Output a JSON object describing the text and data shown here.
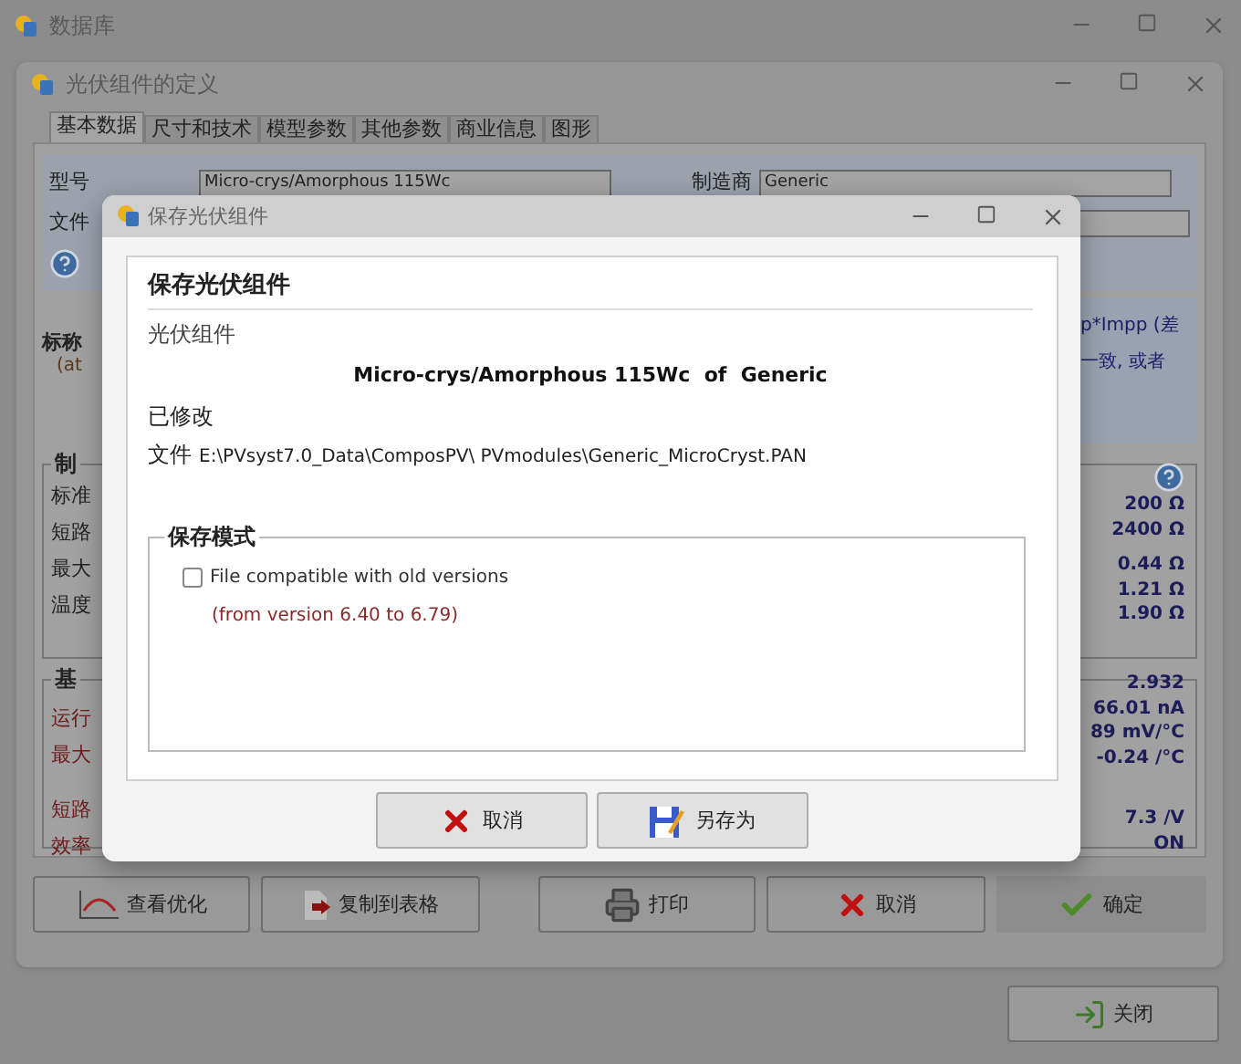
{
  "app_window": {
    "title": "数据库"
  },
  "definition_window": {
    "title": "光伏组件的定义",
    "tabs": [
      {
        "label": "基本数据",
        "selected": true
      },
      {
        "label": "尺寸和技术",
        "selected": false
      },
      {
        "label": "模型参数",
        "selected": false
      },
      {
        "label": "其他参数",
        "selected": false
      },
      {
        "label": "商业信息",
        "selected": false
      },
      {
        "label": "图形",
        "selected": false
      }
    ],
    "model_label": "型号",
    "model_value": "Micro-crys/Amorphous 115Wc",
    "manufacturer_label": "制造商",
    "manufacturer_value": "Generic",
    "file_label": "文件",
    "nominal": {
      "title": "标称",
      "subtitle": "(at",
      "note_lines": [
        "p*Impp (差",
        "一致, 或者"
      ]
    },
    "groups": [
      {
        "title": "制",
        "labels": [
          {
            "text": "标准",
            "warn": false
          },
          {
            "text": "短路",
            "warn": false
          },
          {
            "text": "最大",
            "warn": false
          },
          {
            "text": "温度",
            "warn": false
          }
        ],
        "help": true,
        "values": [
          "200 Ω",
          "2400 Ω",
          "0.44 Ω",
          "1.21 Ω",
          "1.90 Ω"
        ]
      },
      {
        "title": "基",
        "labels": [
          {
            "text": "运行",
            "warn": true
          },
          {
            "text": "最大",
            "warn": true
          },
          {
            "text": "短路",
            "warn": true
          },
          {
            "text": "效率",
            "warn": true
          }
        ],
        "help": false,
        "values": [
          "2.932",
          "66.01 nA",
          "89 mV/°C",
          "-0.24 /°C",
          "7.3 /V",
          "ON"
        ]
      }
    ],
    "buttons": [
      {
        "label": "查看优化",
        "kind": "chart",
        "default": false
      },
      {
        "label": "复制到表格",
        "kind": "copy",
        "default": false
      },
      {
        "label": "打印",
        "kind": "print",
        "default": false
      },
      {
        "label": "取消",
        "kind": "cancel",
        "default": false
      },
      {
        "label": "确定",
        "kind": "ok",
        "default": true
      }
    ]
  },
  "close_button": {
    "label": "关闭"
  },
  "dialog": {
    "title": "保存光伏组件",
    "heading": "保存光伏组件",
    "type_label": "光伏组件",
    "module_name": "Micro-crys/Amorphous 115Wc  of  Generic",
    "status": "已修改",
    "file_label": "文件",
    "file_path": "E:\\PVsyst7.0_Data\\ComposPV\\ PVmodules\\Generic_MicroCryst.PAN",
    "save_mode": {
      "title": "保存模式",
      "option": {
        "label": "File compatible with old versions",
        "checked": false
      },
      "note": "(from version 6.40 to 6.79)"
    },
    "buttons": [
      {
        "label": "取消",
        "kind": "cancel"
      },
      {
        "label": "另存为",
        "kind": "saveas"
      }
    ]
  }
}
